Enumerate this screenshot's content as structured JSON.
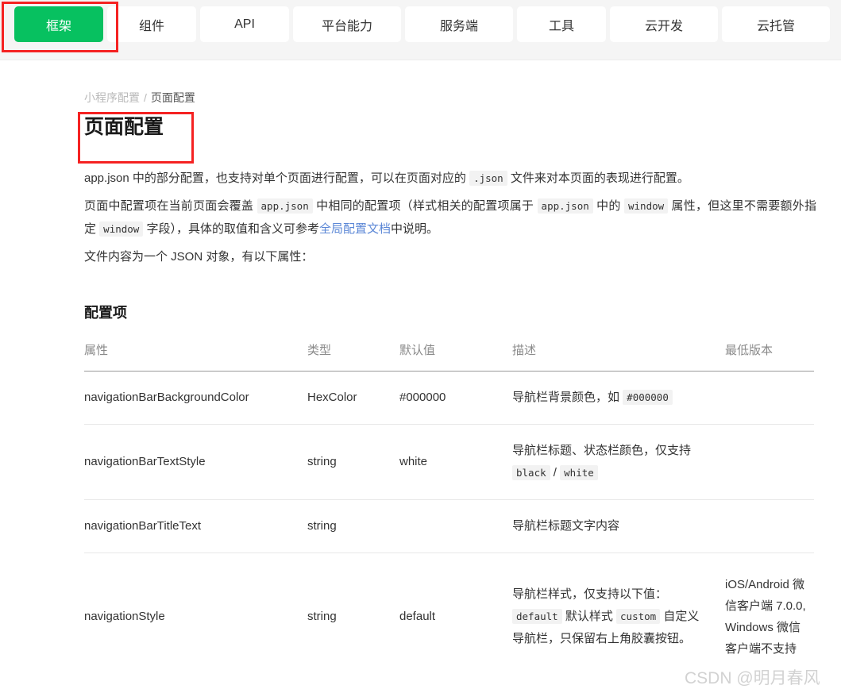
{
  "topnav": {
    "tabs": [
      {
        "label": "框架",
        "active": true
      },
      {
        "label": "组件",
        "active": false
      },
      {
        "label": "API",
        "active": false
      },
      {
        "label": "平台能力",
        "active": false
      },
      {
        "label": "服务端",
        "active": false
      },
      {
        "label": "工具",
        "active": false
      },
      {
        "label": "云开发",
        "active": false
      },
      {
        "label": "云托管",
        "active": false
      }
    ],
    "active_color": "#07c160",
    "annotation_color": "#f52222"
  },
  "breadcrumb": {
    "parent": "小程序配置",
    "separator": "/",
    "current": "页面配置"
  },
  "page_title": "页面配置",
  "paragraphs": {
    "p1": {
      "seg1": "app.json 中的部分配置，也支持对单个页面进行配置，可以在页面对应的 ",
      "code1": ".json",
      "seg2": " 文件来对本页面的表现进行配置。"
    },
    "p2": {
      "seg1": "页面中配置项在当前页面会覆盖 ",
      "code1": "app.json",
      "seg2": " 中相同的配置项（样式相关的配置项属于 ",
      "code2": "app.json",
      "seg3": " 中的 ",
      "code3": "window",
      "seg4": " 属性，但这里不需要额外指定 ",
      "code4": "window",
      "seg5": " 字段），具体的取值和含义可参考",
      "link": "全局配置文档",
      "seg6": "中说明。"
    },
    "p3": "文件内容为一个 JSON 对象，有以下属性："
  },
  "section_title": "配置项",
  "table": {
    "headers": [
      "属性",
      "类型",
      "默认值",
      "描述",
      "最低版本"
    ],
    "rows": [
      {
        "attr": "navigationBarBackgroundColor",
        "type": "HexColor",
        "default": "#000000",
        "desc_seg1": "导航栏背景颜色，如 ",
        "desc_code1": "#000000",
        "desc_seg2": "",
        "desc_code2": "",
        "desc_seg3": "",
        "desc_code3": "",
        "desc_seg4": "",
        "version": ""
      },
      {
        "attr": "navigationBarTextStyle",
        "type": "string",
        "default": "white",
        "desc_seg1": "导航栏标题、状态栏颜色，仅支持 ",
        "desc_code1": "black",
        "desc_seg2": " / ",
        "desc_code2": "white",
        "desc_seg3": "",
        "desc_code3": "",
        "desc_seg4": "",
        "version": ""
      },
      {
        "attr": "navigationBarTitleText",
        "type": "string",
        "default": "",
        "desc_seg1": "导航栏标题文字内容",
        "desc_code1": "",
        "desc_seg2": "",
        "desc_code2": "",
        "desc_seg3": "",
        "desc_code3": "",
        "desc_seg4": "",
        "version": ""
      },
      {
        "attr": "navigationStyle",
        "type": "string",
        "default": "default",
        "desc_seg1": "导航栏样式，仅支持以下值： ",
        "desc_code1": "default",
        "desc_seg2": " 默认样式 ",
        "desc_code2": "custom",
        "desc_seg3": " 自定义导航栏，只保留右上角胶囊按钮。",
        "desc_code3": "",
        "desc_seg4": "",
        "version": "iOS/Android 微信客户端 7.0.0, Windows 微信客户端不支持"
      }
    ]
  },
  "watermark": "CSDN @明月春风"
}
